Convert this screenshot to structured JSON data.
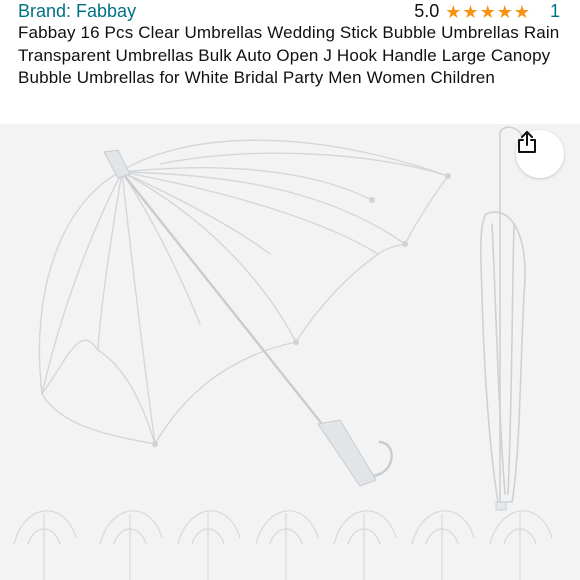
{
  "header": {
    "brand": "Brand: Fabbay",
    "rating_value": "5.0",
    "rating_stars": 5,
    "rating_count": "1",
    "title": "Fabbay 16 Pcs Clear Umbrellas Wedding Stick Bubble Umbrellas Rain Transparent Umbrellas Bulk Auto Open J Hook Handle Large Canopy Bubble Umbrellas for White Bridal Party Men Women Children"
  },
  "image": {
    "thumbnail_umbrella_count": 7
  },
  "icons": {
    "star": "star-icon",
    "share": "share-icon"
  },
  "colors": {
    "link": "#007185",
    "star": "#f79413",
    "text": "#0f1111",
    "image_bg": "#f3f3f3"
  }
}
